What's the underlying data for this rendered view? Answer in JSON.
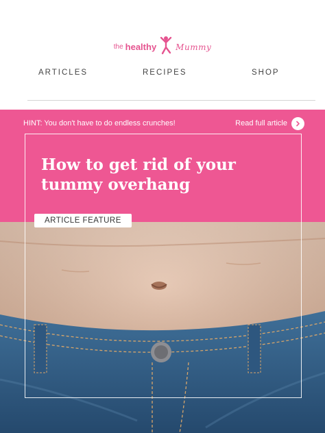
{
  "brand": {
    "the": "the",
    "healthy": "healthy",
    "mummy": "Mummy",
    "color": "#e5538f"
  },
  "nav": {
    "items": [
      "ARTICLES",
      "RECIPES",
      "SHOP"
    ]
  },
  "hero": {
    "hint": "HINT: You don't have to do endless crunches!",
    "read_link": "Read full article",
    "title": "How to get rid of your tummy overhang",
    "badge": "ARTICLE FEATURE",
    "accent": "#ee5793",
    "arrow_icon": "chevron-right-icon"
  }
}
